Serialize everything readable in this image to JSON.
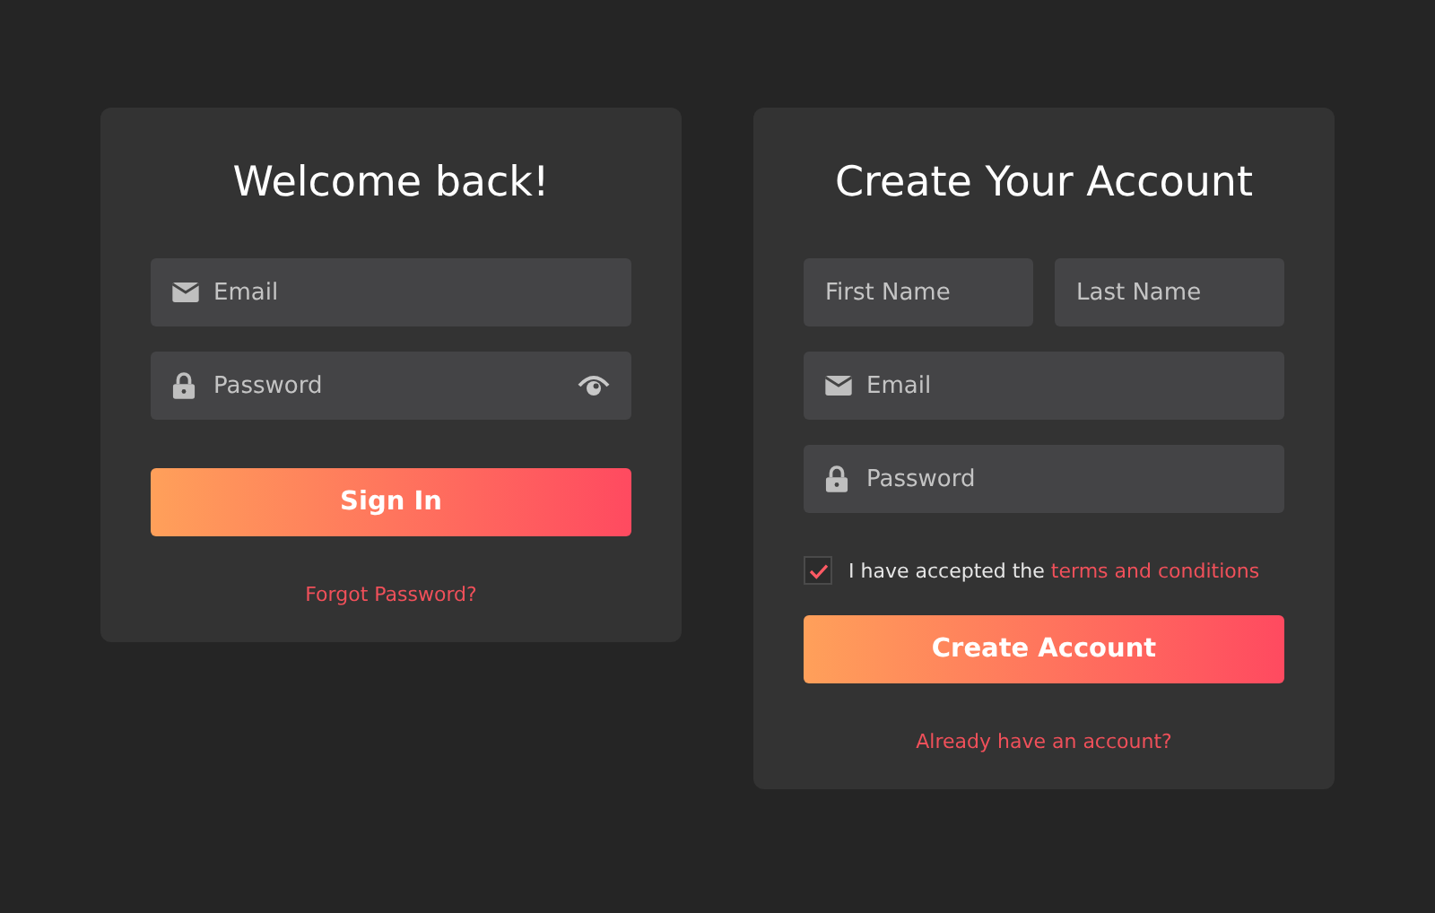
{
  "login": {
    "title": "Welcome back!",
    "fields": [
      {
        "kind": "email",
        "placeholder": "Email"
      },
      {
        "kind": "password",
        "placeholder": "Password",
        "reveal": true
      }
    ],
    "button": "Sign In",
    "link": "Forgot Password?"
  },
  "register": {
    "title": "Create Your Account",
    "name_fields": [
      {
        "placeholder": "First Name"
      },
      {
        "placeholder": "Last Name"
      }
    ],
    "fields": [
      {
        "kind": "email",
        "placeholder": "Email"
      },
      {
        "kind": "password",
        "placeholder": "Password",
        "reveal": false
      }
    ],
    "consent": {
      "checked": true,
      "text": "I have accepted the",
      "link": "terms and conditions"
    },
    "button": "Create Account",
    "link": "Already have an account?"
  }
}
